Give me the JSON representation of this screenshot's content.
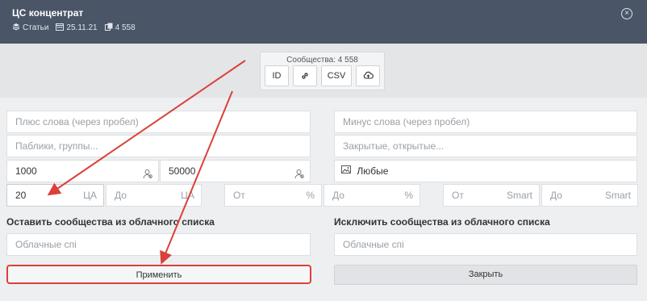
{
  "header": {
    "title": "ЦС концентрат",
    "category": "Статьи",
    "date": "25.11.21",
    "count": "4 558"
  },
  "toolbox": {
    "label": "Сообщества: 4 558",
    "id_label": "ID",
    "csv_label": "CSV"
  },
  "filters": {
    "plus_words_placeholder": "Плюс слова (через пробел)",
    "minus_words_placeholder": "Минус слова (через пробел)",
    "groups_placeholder": "Паблики, группы...",
    "closed_open_placeholder": "Закрытые, открытые...",
    "members_from": "1000",
    "members_to": "50000",
    "image_filter": "Любые",
    "ca_from": "20",
    "ca_suffix": "ЦА",
    "ca_to_placeholder": "До",
    "pct_from_placeholder": "От",
    "pct_to_placeholder": "До",
    "pct_suffix": "%",
    "smart_from_placeholder": "От",
    "smart_to_placeholder": "До",
    "smart_suffix": "Smart"
  },
  "cloud": {
    "keep_label": "Оставить сообщества из облачного списка",
    "exclude_label": "Исключить сообщества из облачного списка",
    "keep_placeholder": "Облачные спі",
    "exclude_placeholder": "Облачные спі"
  },
  "actions": {
    "apply_label": "Применить",
    "close_label": "Закрыть"
  },
  "colors": {
    "header_bg": "#4a5568",
    "highlight": "#d9413a"
  }
}
